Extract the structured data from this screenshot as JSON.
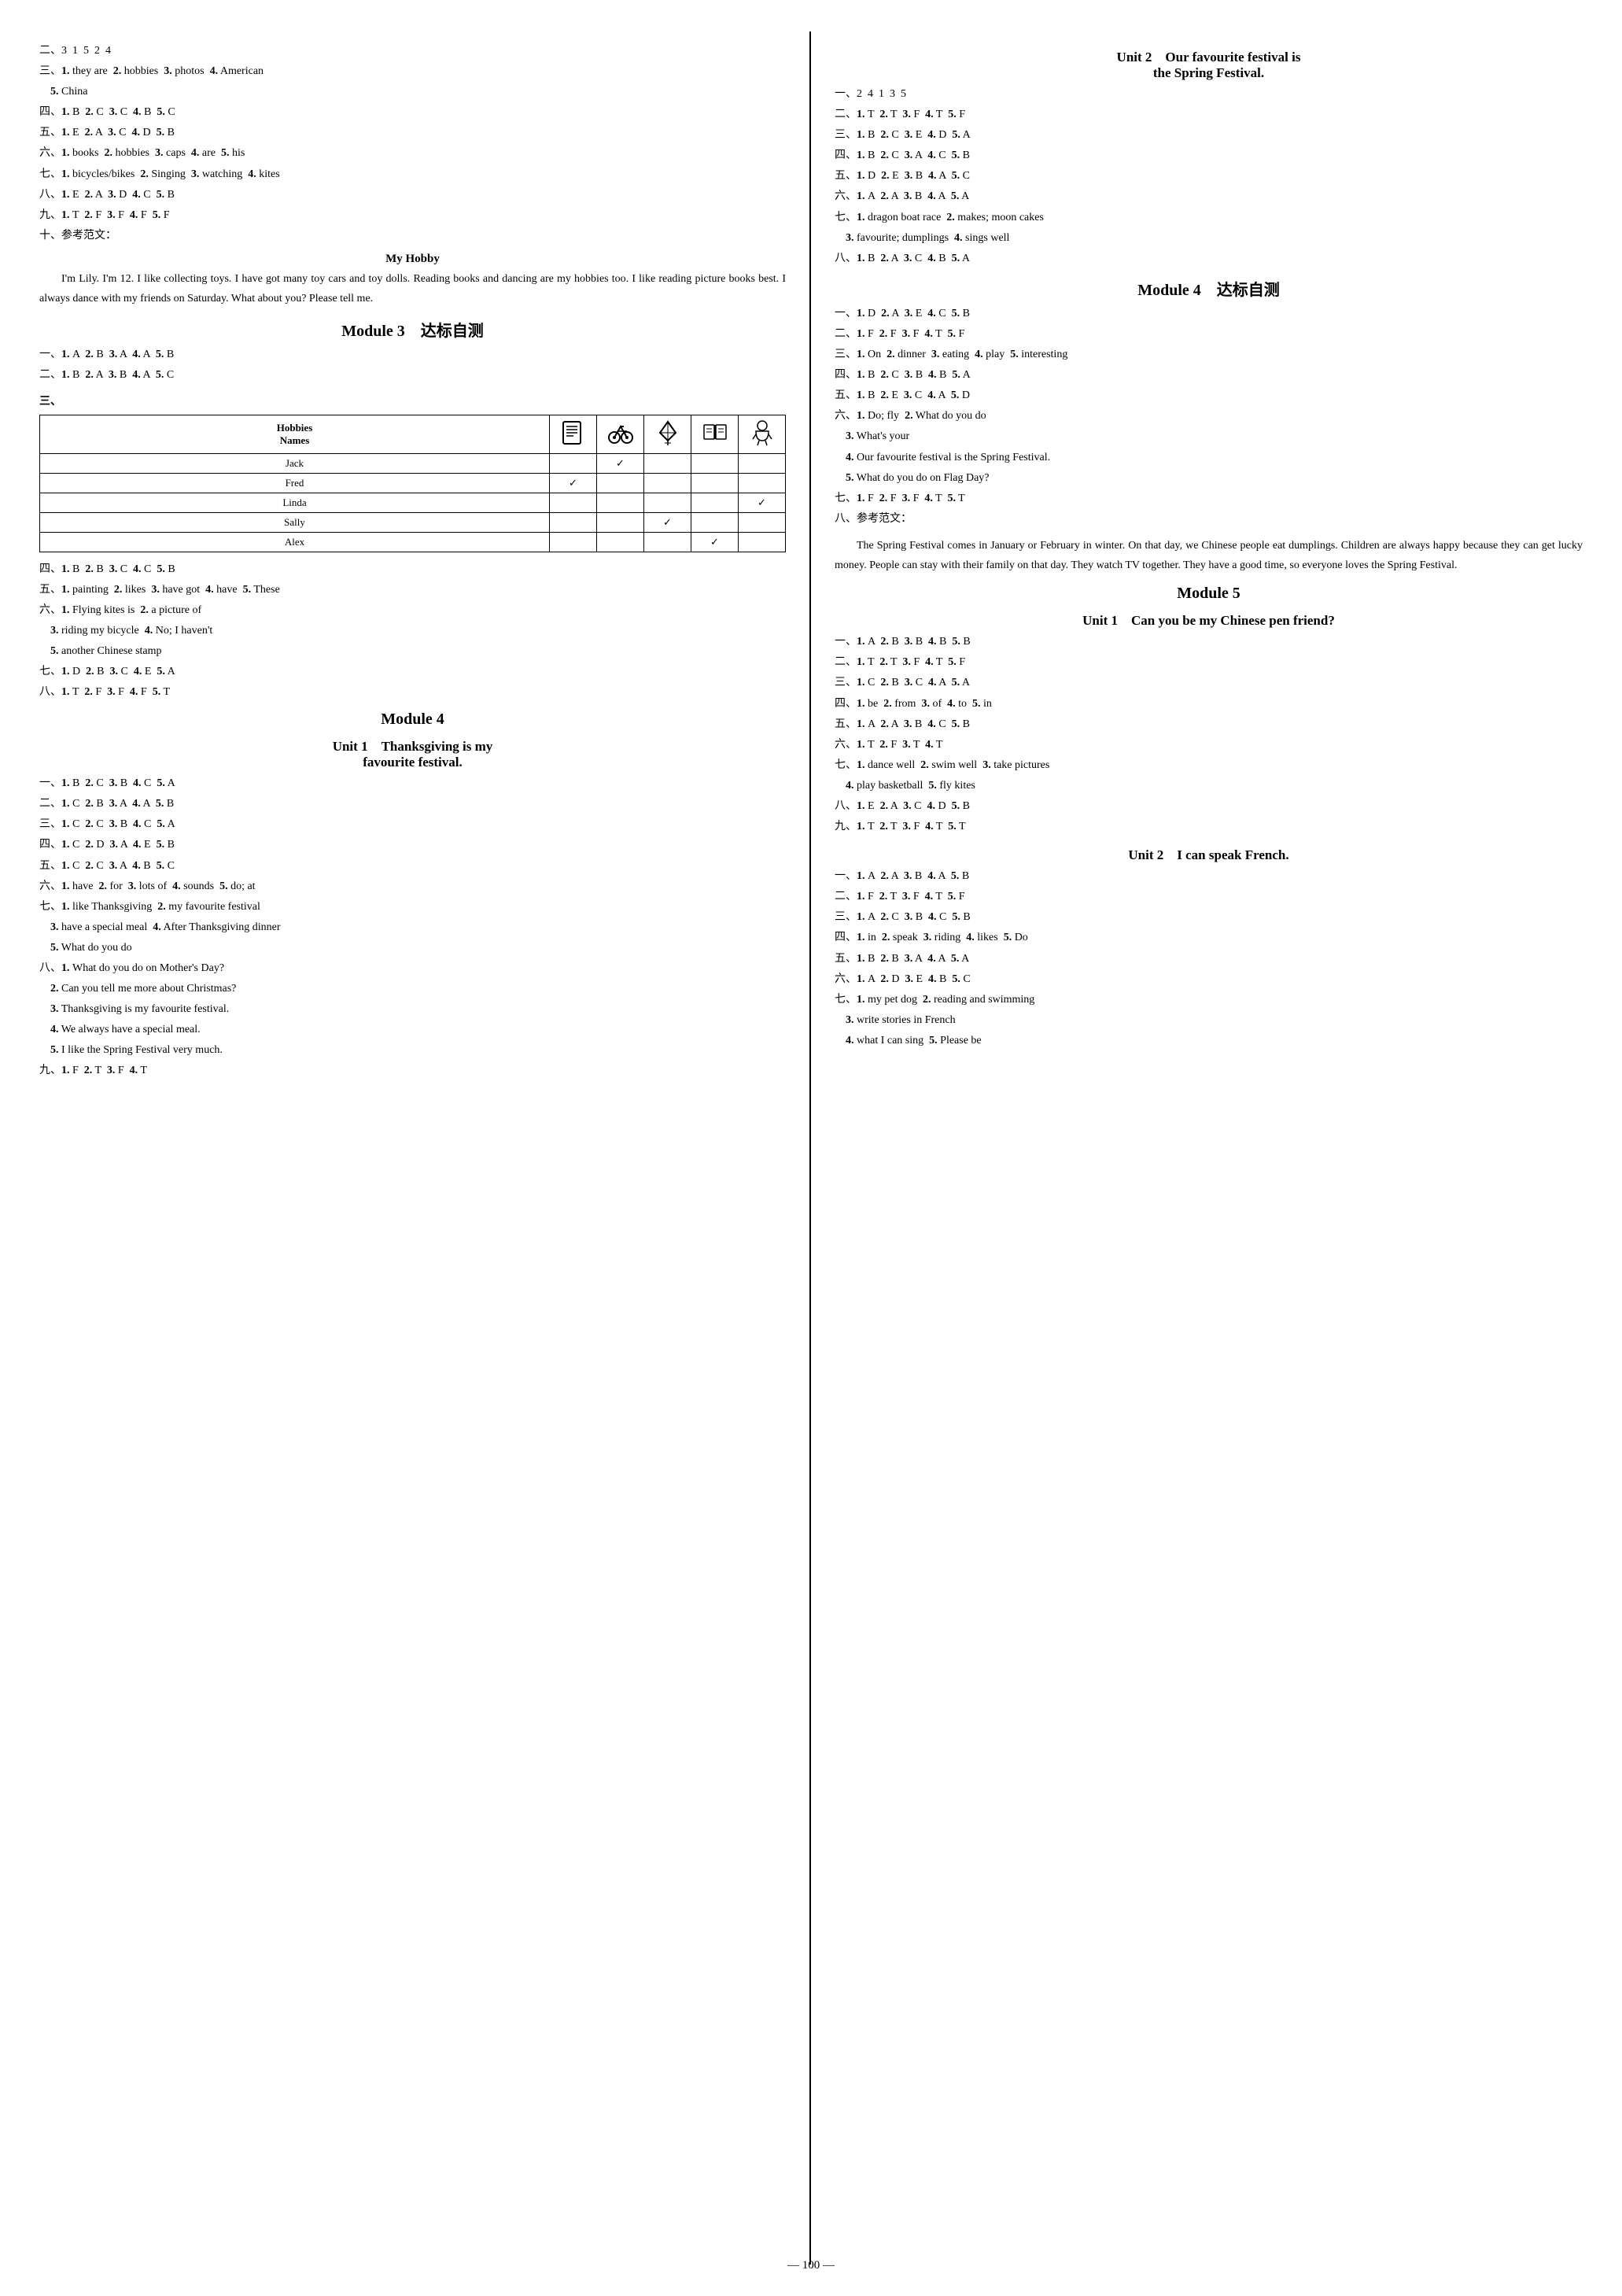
{
  "page_number": "— 100 —",
  "left": {
    "sections": [
      {
        "id": "left-top-answers",
        "lines": [
          "二、3  1  5  2  4",
          "三、1. they are  2. hobbies  3. photos  4. American",
          "　　5. China",
          "四、1. B  2. C  3. C  4. B  5. C",
          "五、1. E  2. A  3. C  4. D  5. B",
          "六、1. books  2. hobbies  3. caps  4. are  5. his",
          "七、1. bicycles/bikes  2. Singing  3. watching  4. kites",
          "八、1. E  2. A  3. D  4. C  5. B",
          "九、1. T  2. F  3. F  4. F  5. F",
          "十、参考范文："
        ]
      },
      {
        "id": "essay-my-hobby",
        "title": "My Hobby",
        "body": "I'm Lily. I'm 12. I like collecting toys. I have got many toy cars and toy dolls. Reading books and dancing are my hobbies too. I like reading picture books best. I always dance with my friends on Saturday. What about you? Please tell me."
      },
      {
        "id": "module3-title",
        "text": "Module 3　达标自测"
      },
      {
        "id": "module3-answers",
        "lines": [
          "一、1. A  2. B  3. A  4. A  5. B",
          "二、1. B  2. A  3. B  4. A  5. C"
        ]
      },
      {
        "id": "table-section",
        "label": "三、",
        "table": {
          "headers": [
            "Hobbies",
            "icon1",
            "icon2",
            "icon3",
            "icon4",
            "icon5"
          ],
          "header_labels": [
            "Hobbies",
            "",
            "",
            "",
            "",
            ""
          ],
          "rows": [
            {
              "name": "Jack",
              "checks": [
                false,
                true,
                false,
                false,
                false
              ]
            },
            {
              "name": "Fred",
              "checks": [
                true,
                false,
                false,
                false,
                false
              ]
            },
            {
              "name": "Linda",
              "checks": [
                false,
                false,
                false,
                false,
                true
              ]
            },
            {
              "name": "Sally",
              "checks": [
                false,
                false,
                true,
                false,
                false
              ]
            },
            {
              "name": "Alex",
              "checks": [
                false,
                false,
                false,
                true,
                false
              ]
            }
          ]
        }
      },
      {
        "id": "module3-more-answers",
        "lines": [
          "四、1. B  2. B  3. C  4. C  5. B",
          "五、1. painting  2. likes  3. have got  4. have  5. These",
          "六、1. Flying kites is  2. a picture of",
          "　　3. riding my bicycle  4. No; I haven't",
          "　　5. another Chinese stamp",
          "七、1. D  2. B  3. C  4. E  5. A",
          "八、1. T  2. F  3. F  4. F  5. T"
        ]
      },
      {
        "id": "module4-title",
        "text": "Module 4"
      },
      {
        "id": "unit1-thanksgiving-title",
        "text": "Unit 1　Thanksgiving is my",
        "text2": "favourite festival."
      },
      {
        "id": "module4-unit1-answers",
        "lines": [
          "一、1. B  2. C  3. B  4. C  5. A",
          "二、1. C  2. B  3. A  4. A  5. B",
          "三、1. C  2. C  3. B  4. C  5. A",
          "四、1. C  2. D  3. A  4. E  5. B",
          "五、1. C  2. C  3. A  4. B  5. C",
          "六、1. have  2. for  3. lots of  4. sounds  5. do; at",
          "七、1. like Thanksgiving  2. my favourite festival",
          "　　3. have a special meal  4. After Thanksgiving dinner",
          "　　5. What do you do",
          "八、1. What do you do on Mother's Day?",
          "　　2. Can you tell me more about Christmas?",
          "　　3. Thanksgiving is my favourite festival.",
          "　　4. We always have a special meal.",
          "　　5. I like the Spring Festival very much.",
          "九、1. F  2. T  3. F  4. T"
        ]
      }
    ]
  },
  "right": {
    "sections": [
      {
        "id": "unit2-spring-festival-title",
        "text": "Unit 2　Our favourite festival is",
        "text2": "the Spring Festival."
      },
      {
        "id": "spring-festival-answers",
        "lines": [
          "一、2  4  1  3  5",
          "二、1. T  2. T  3. F  4. T  5. F",
          "三、1. B  2. C  3. E  4. D  5. A",
          "四、1. B  2. C  3. A  4. C  5. B",
          "五、1. D  2. E  3. B  4. A  5. C",
          "六、1. A  2. A  3. B  4. A  5. A",
          "七、1. dragon boat race  2. makes; moon cakes",
          "　　3. favourite; dumplings  4. sings well",
          "八、1. B  2. A  3. C  4. B  5. A"
        ]
      },
      {
        "id": "module4-self-test-title",
        "text": "Module 4　达标自测"
      },
      {
        "id": "module4-self-test-answers",
        "lines": [
          "一、1. D  2. A  3. E  4. C  5. B",
          "二、1. F  2. F  3. F  4. T  5. F",
          "三、1. On  2. dinner  3. eating  4. play  5. interesting",
          "四、1. B  2. C  3. B  4. B  5. A",
          "五、1. B  2. E  3. C  4. A  5. D",
          "六、1. Do; fly  2. What do you do",
          "　　3. What's your",
          "　　4. Our favourite festival is the Spring Festival.",
          "　　5. What do you do on Flag Day?",
          "七、1. F  2. F  3. F  4. T  5. T",
          "八、参考范文："
        ]
      },
      {
        "id": "essay-spring-festival",
        "body": "The Spring Festival comes in January or February in winter. On that day, we Chinese people eat dumplings. Children are always happy because they can get lucky money. People can stay with their family on that day. They watch TV together. They have a good time, so everyone loves the Spring Festival."
      },
      {
        "id": "module5-title",
        "text": "Module 5"
      },
      {
        "id": "unit1-pen-friend-title",
        "text": "Unit 1　Can you be my Chinese pen friend?"
      },
      {
        "id": "pen-friend-answers",
        "lines": [
          "一、1. A  2. B  3. B  4. B  5. B",
          "二、1. T  2. T  3. F  4. T  5. F",
          "三、1. C  2. B  3. C  4. A  5. A",
          "四、1. be  2. from  3. of  4. to  5. in",
          "五、1. A  2. A  3. B  4. C  5. B",
          "六、1. T  2. F  3. T  4. T",
          "七、1. dance well  2. swim well  3. take pictures",
          "　　4. play basketball  5. fly kites",
          "八、1. E  2. A  3. C  4. D  5. B",
          "九、1. T  2. T  3. F  4. T  5. T"
        ]
      },
      {
        "id": "unit2-french-title",
        "text": "Unit 2　I can speak French."
      },
      {
        "id": "french-answers",
        "lines": [
          "一、1. A  2. A  3. B  4. A  5. B",
          "二、1. F  2. T  3. F  4. T  5. F",
          "三、1. A  2. C  3. B  4. C  5. B",
          "四、1. in  2. speak  3. riding  4. likes  5. Do",
          "五、1. B  2. B  3. A  4. A  5. A",
          "六、1. A  2. D  3. E  4. B  5. C",
          "七、1. my pet dog  2. reading and swimming",
          "　　3. write stories in French",
          "　　4. what I can sing  5. Please be"
        ]
      }
    ]
  }
}
